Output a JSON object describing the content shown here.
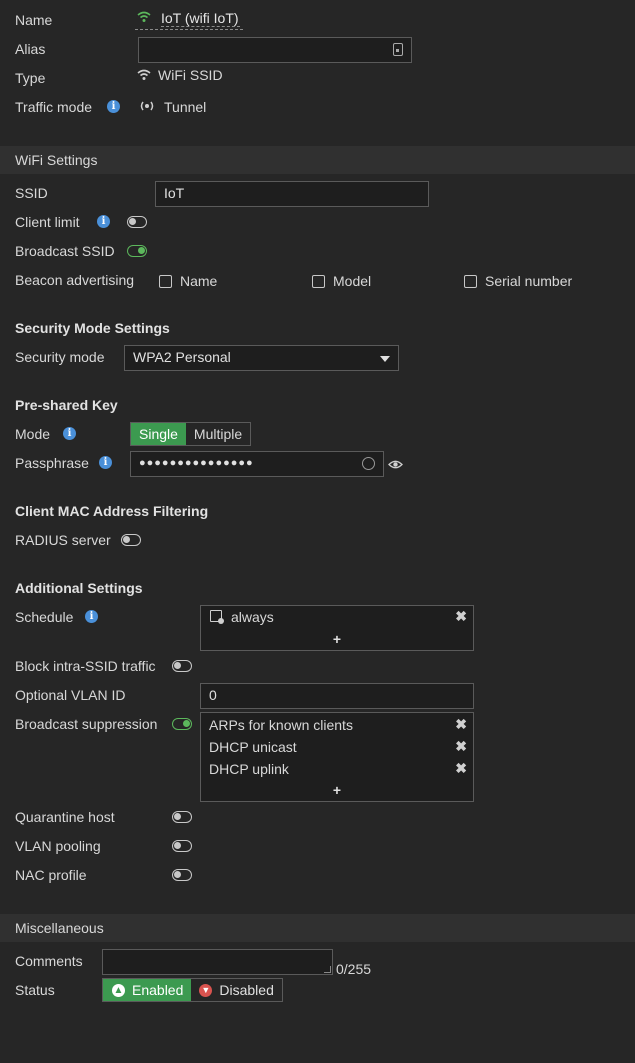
{
  "general": {
    "name_label": "Name",
    "name_value": "IoT (wifi IoT)",
    "alias_label": "Alias",
    "alias_value": "",
    "type_label": "Type",
    "type_value": "WiFi SSID",
    "traffic_mode_label": "Traffic mode",
    "traffic_mode_value": "Tunnel"
  },
  "wifi_settings": {
    "title": "WiFi Settings",
    "ssid_label": "SSID",
    "ssid_value": "IoT",
    "client_limit_label": "Client limit",
    "client_limit_on": false,
    "broadcast_ssid_label": "Broadcast SSID",
    "broadcast_ssid_on": true,
    "beacon_label": "Beacon advertising",
    "beacon_options": [
      {
        "label": "Name",
        "checked": false
      },
      {
        "label": "Model",
        "checked": false
      },
      {
        "label": "Serial number",
        "checked": false
      }
    ]
  },
  "security": {
    "title": "Security Mode Settings",
    "mode_label": "Security mode",
    "mode_value": "WPA2 Personal"
  },
  "psk": {
    "title": "Pre-shared Key",
    "mode_label": "Mode",
    "mode_options": [
      "Single",
      "Multiple"
    ],
    "mode_selected": "Single",
    "passphrase_label": "Passphrase",
    "passphrase_value": "●●●●●●●●●●●●●●●"
  },
  "mac_filter": {
    "title": "Client MAC Address Filtering",
    "radius_label": "RADIUS server",
    "radius_on": false
  },
  "additional": {
    "title": "Additional Settings",
    "schedule_label": "Schedule",
    "schedule_items": [
      "always"
    ],
    "block_intra_label": "Block intra-SSID traffic",
    "block_intra_on": false,
    "vlan_label": "Optional VLAN ID",
    "vlan_value": "0",
    "bcast_supp_label": "Broadcast suppression",
    "bcast_supp_on": true,
    "bcast_supp_items": [
      "ARPs for known clients",
      "DHCP unicast",
      "DHCP uplink"
    ],
    "quarantine_label": "Quarantine host",
    "vlan_pooling_label": "VLAN pooling",
    "nac_label": "NAC profile",
    "add_symbol": "+",
    "remove_symbol": "✖"
  },
  "misc": {
    "title": "Miscellaneous",
    "comments_label": "Comments",
    "comments_counter": "0/255",
    "status_label": "Status",
    "status_enabled": "Enabled",
    "status_disabled": "Disabled"
  },
  "colors": {
    "background": "#262626",
    "section_bar": "#303030",
    "accent_green": "#3c9a50",
    "info_blue": "#4a90d9",
    "disabled_red": "#d9534f"
  }
}
